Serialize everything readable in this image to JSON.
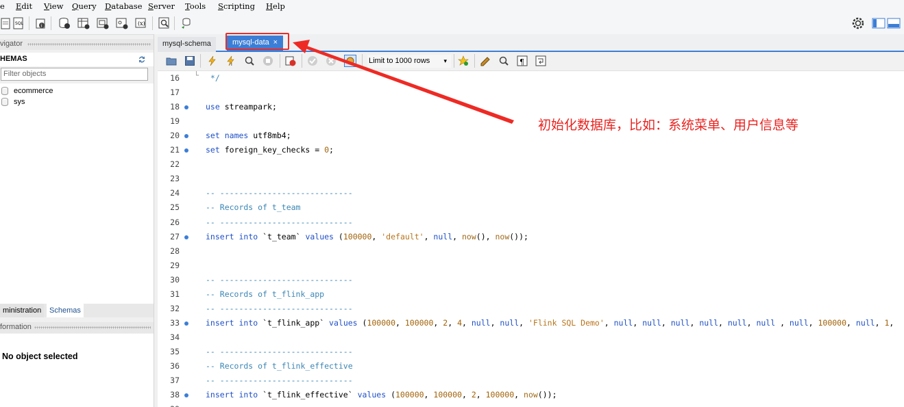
{
  "menu": [
    "e",
    "Edit",
    "View",
    "Query",
    "Database",
    "Server",
    "Tools",
    "Scripting",
    "Help"
  ],
  "menu_mnemonics": [
    "",
    "E",
    "V",
    "Q",
    "D",
    "S",
    "T",
    "S",
    "H"
  ],
  "navigator": {
    "header": "vigator",
    "schemas_title": "HEMAS",
    "filter_placeholder": "Filter objects",
    "schemas": [
      "ecommerce",
      "sys"
    ]
  },
  "left_tabs": [
    "ministration",
    "Schemas"
  ],
  "information": {
    "header": "formation",
    "empty_text": "No object selected"
  },
  "tabs": [
    {
      "label": "mysql-schema"
    },
    {
      "label": "mysql-data",
      "close": "×"
    }
  ],
  "editor_toolbar": {
    "limit_rows": "Limit to 1000 rows",
    "dropdown_arrow": "▾"
  },
  "annotation": "初始化数据库，比如：系统菜单、用户信息等",
  "editor": {
    "lines": [
      {
        "n": "16",
        "dot": false,
        "fold": "└",
        "code": [
          [
            "cm",
            " */"
          ]
        ]
      },
      {
        "n": "17",
        "dot": false,
        "code": []
      },
      {
        "n": "18",
        "dot": true,
        "code": [
          [
            "kw",
            "use"
          ],
          [
            "",
            " streampark;"
          ]
        ]
      },
      {
        "n": "19",
        "dot": false,
        "code": []
      },
      {
        "n": "20",
        "dot": true,
        "code": [
          [
            "kw",
            "set"
          ],
          [
            "",
            " "
          ],
          [
            "kw",
            "names"
          ],
          [
            "",
            " utf8mb4;"
          ]
        ]
      },
      {
        "n": "21",
        "dot": true,
        "code": [
          [
            "kw",
            "set"
          ],
          [
            "",
            " foreign_key_checks = "
          ],
          [
            "num",
            "0"
          ],
          [
            "",
            ";"
          ]
        ]
      },
      {
        "n": "22",
        "dot": false,
        "code": []
      },
      {
        "n": "23",
        "dot": false,
        "code": []
      },
      {
        "n": "24",
        "dot": false,
        "code": [
          [
            "cm",
            "-- ----------------------------"
          ]
        ]
      },
      {
        "n": "25",
        "dot": false,
        "code": [
          [
            "cm",
            "-- Records of t_team"
          ]
        ]
      },
      {
        "n": "26",
        "dot": false,
        "code": [
          [
            "cm",
            "-- ----------------------------"
          ]
        ]
      },
      {
        "n": "27",
        "dot": true,
        "code": [
          [
            "kw",
            "insert"
          ],
          [
            "",
            " "
          ],
          [
            "kw",
            "into"
          ],
          [
            "",
            " `t_team` "
          ],
          [
            "kw",
            "values"
          ],
          [
            "",
            " ("
          ],
          [
            "num",
            "100000"
          ],
          [
            "",
            ", "
          ],
          [
            "str",
            "'default'"
          ],
          [
            "",
            ", "
          ],
          [
            "kw",
            "null"
          ],
          [
            "",
            ", "
          ],
          [
            "fn",
            "now"
          ],
          [
            "",
            "(), "
          ],
          [
            "fn",
            "now"
          ],
          [
            "",
            "());"
          ]
        ]
      },
      {
        "n": "28",
        "dot": false,
        "code": []
      },
      {
        "n": "29",
        "dot": false,
        "code": []
      },
      {
        "n": "30",
        "dot": false,
        "code": [
          [
            "cm",
            "-- ----------------------------"
          ]
        ]
      },
      {
        "n": "31",
        "dot": false,
        "code": [
          [
            "cm",
            "-- Records of t_flink_app"
          ]
        ]
      },
      {
        "n": "32",
        "dot": false,
        "code": [
          [
            "cm",
            "-- ----------------------------"
          ]
        ]
      },
      {
        "n": "33",
        "dot": true,
        "code": [
          [
            "kw",
            "insert"
          ],
          [
            "",
            " "
          ],
          [
            "kw",
            "into"
          ],
          [
            "",
            " `t_flink_app` "
          ],
          [
            "kw",
            "values"
          ],
          [
            "",
            " ("
          ],
          [
            "num",
            "100000"
          ],
          [
            "",
            ", "
          ],
          [
            "num",
            "100000"
          ],
          [
            "",
            ", "
          ],
          [
            "num",
            "2"
          ],
          [
            "",
            ", "
          ],
          [
            "num",
            "4"
          ],
          [
            "",
            ", "
          ],
          [
            "kw",
            "null"
          ],
          [
            "",
            ", "
          ],
          [
            "kw",
            "null"
          ],
          [
            "",
            ", "
          ],
          [
            "str",
            "'Flink SQL Demo'"
          ],
          [
            "",
            ", "
          ],
          [
            "kw",
            "null"
          ],
          [
            "",
            ", "
          ],
          [
            "kw",
            "null"
          ],
          [
            "",
            ", "
          ],
          [
            "kw",
            "null"
          ],
          [
            "",
            ", "
          ],
          [
            "kw",
            "null"
          ],
          [
            "",
            ", "
          ],
          [
            "kw",
            "null"
          ],
          [
            "",
            ", "
          ],
          [
            "kw",
            "null"
          ],
          [
            "",
            " , "
          ],
          [
            "kw",
            "null"
          ],
          [
            "",
            ", "
          ],
          [
            "num",
            "100000"
          ],
          [
            "",
            ", "
          ],
          [
            "kw",
            "null"
          ],
          [
            "",
            ", "
          ],
          [
            "num",
            "1"
          ],
          [
            "",
            ","
          ]
        ]
      },
      {
        "n": "34",
        "dot": false,
        "code": []
      },
      {
        "n": "35",
        "dot": false,
        "code": [
          [
            "cm",
            "-- ----------------------------"
          ]
        ]
      },
      {
        "n": "36",
        "dot": false,
        "code": [
          [
            "cm",
            "-- Records of t_flink_effective"
          ]
        ]
      },
      {
        "n": "37",
        "dot": false,
        "code": [
          [
            "cm",
            "-- ----------------------------"
          ]
        ]
      },
      {
        "n": "38",
        "dot": true,
        "code": [
          [
            "kw",
            "insert"
          ],
          [
            "",
            " "
          ],
          [
            "kw",
            "into"
          ],
          [
            "",
            " `t_flink_effective` "
          ],
          [
            "kw",
            "values"
          ],
          [
            "",
            " ("
          ],
          [
            "num",
            "100000"
          ],
          [
            "",
            ", "
          ],
          [
            "num",
            "100000"
          ],
          [
            "",
            ", "
          ],
          [
            "num",
            "2"
          ],
          [
            "",
            ", "
          ],
          [
            "num",
            "100000"
          ],
          [
            "",
            ", "
          ],
          [
            "fn",
            "now"
          ],
          [
            "",
            "());"
          ]
        ]
      },
      {
        "n": "39",
        "dot": false,
        "code": []
      }
    ]
  },
  "colors": {
    "accent": "#3c7ed6",
    "annotation_red": "#ee2a24",
    "keyword": "#1e4fc7",
    "comment": "#3b86b5",
    "string": "#b8741a"
  }
}
